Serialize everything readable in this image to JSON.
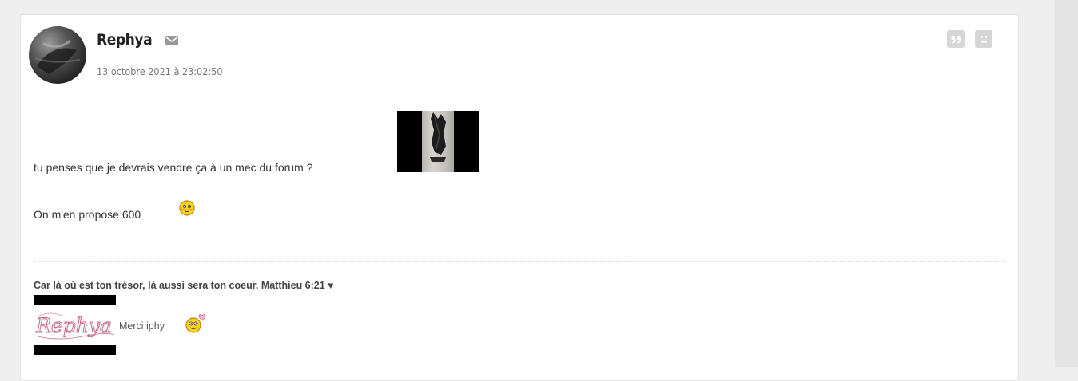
{
  "post": {
    "author": "Rephya",
    "date": "13 octobre 2021 à 23:02:50",
    "body_line1": "tu penses que je devrais vendre ça à un mec du forum ?",
    "body_line2": "On m'en propose 600",
    "signature": {
      "quote": "Car là où est ton trésor, là aussi sera ton coeur. Matthieu 6:21 ♥",
      "logo_text": "Rephya",
      "thanks_text": "Merci iphy"
    }
  },
  "icons": {
    "mail": "envelope-icon",
    "quote": "quote-icon",
    "report": "report-face-icon",
    "smiley_blush": "blush-smiley-icon",
    "smiley_love": "love-smiley-icon"
  },
  "colors": {
    "background": "#eeeeee",
    "card": "#ffffff",
    "icon_gray": "#d6d6d6",
    "author_text": "#222222",
    "date_text": "#777777",
    "logo_pink": "#c9708a"
  }
}
